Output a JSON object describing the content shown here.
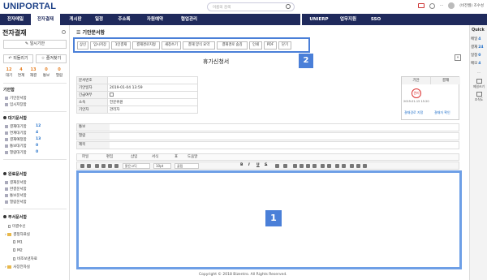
{
  "top": {
    "logo": "UNIPORTAL",
    "search_placeholder": "이름의 검색",
    "user": "(비전웹) 조수성"
  },
  "nav": {
    "items": [
      "전자메일",
      "전자결재",
      "게시판",
      "일정",
      "주소록",
      "자원예약",
      "협업관리"
    ],
    "right_items": [
      "UNIERP",
      "업무지원",
      "SSO"
    ]
  },
  "sidebar": {
    "title": "전자결재",
    "draft_label": "일시기안",
    "recall_label": "되돌리기",
    "favorite_label": "즐겨찾기",
    "stats": [
      {
        "n": "12",
        "l": "대기"
      },
      {
        "n": "4",
        "l": "연계"
      },
      {
        "n": "13",
        "l": "재결"
      },
      {
        "n": "0",
        "l": "통보"
      },
      {
        "n": "0",
        "l": "열람"
      }
    ],
    "draft_section": "기안함",
    "draft_items": [
      "기안문서함",
      "임시저장함"
    ],
    "wait_section": "대기문서함",
    "wait_items": [
      {
        "label": "결재대기함",
        "count": "12"
      },
      {
        "label": "연계대기함",
        "count": "4"
      },
      {
        "label": "결재예정함",
        "count": "13"
      },
      {
        "label": "통보대기함",
        "count": "0"
      },
      {
        "label": "열람대기함",
        "count": "0"
      }
    ],
    "done_section": "완료문서함",
    "done_items": [
      "결재문서함",
      "완결문서함",
      "통보문서함",
      "열람문서함"
    ],
    "dept_section": "부서문서함",
    "tree": [
      "미결수신",
      "결정자료실",
      "M1",
      "M2",
      "비조보낸자료",
      "사장전자실"
    ]
  },
  "main": {
    "breadcrumb": "기안문서함",
    "toolbar": [
      "상신",
      "임시저장",
      "1인결재",
      "결재경로지정",
      "새창쓰기",
      "결재 양식 요약",
      "결재경로 숨김",
      "인쇄",
      "PDF",
      "닫기"
    ],
    "badge2": "2",
    "badge1": "1",
    "doc_title": "휴가신청서",
    "expand": "»",
    "info": [
      {
        "k": "문서번호",
        "v": ""
      },
      {
        "k": "기안일자",
        "v": "2019-01-04 13:59"
      },
      {
        "k": "긴급여부",
        "v": ""
      },
      {
        "k": "소속",
        "v": "전문위원"
      },
      {
        "k": "기안자",
        "v": "관리자"
      }
    ],
    "approve": {
      "head1": "기안",
      "head2": "결재",
      "stamp": "관리",
      "date": "2019-01-15 15:20",
      "link1": "결재경로 지정",
      "link2": "결재자 확인"
    },
    "ref_rows": [
      "통보",
      "열람",
      "제목"
    ],
    "menubar": [
      "파일",
      "편집",
      "삽입",
      "서식",
      "표",
      "도움말"
    ],
    "fmt_labels": {
      "font": "맑은고딕",
      "size": "10pt",
      "style": "굴림",
      "b": "B",
      "i": "I",
      "u": "U",
      "s": "S"
    },
    "footer": "Copyright © 2018 Bizentro. All Rights Reserved."
  },
  "quick": {
    "title": "Quick",
    "items": [
      {
        "l": "메일",
        "v": "4"
      },
      {
        "l": "결재",
        "v": "24"
      },
      {
        "l": "일정",
        "v": "0"
      },
      {
        "l": "메모",
        "v": "4"
      }
    ],
    "btn1": "메일쓰기",
    "btn2": "조직도"
  }
}
